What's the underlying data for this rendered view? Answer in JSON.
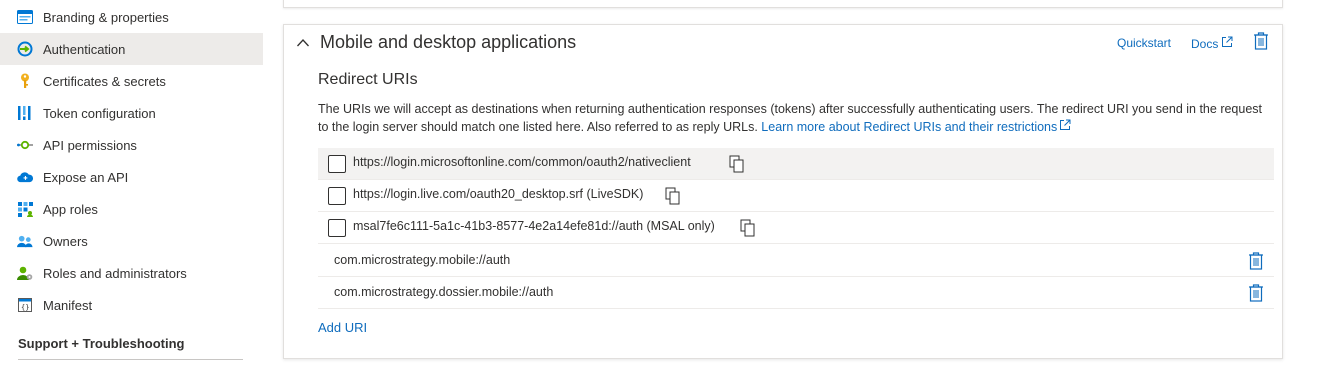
{
  "sidebar": {
    "items": [
      {
        "label": "Branding & properties",
        "icon": "branding-icon"
      },
      {
        "label": "Authentication",
        "icon": "authentication-icon",
        "active": true
      },
      {
        "label": "Certificates & secrets",
        "icon": "key-icon"
      },
      {
        "label": "Token configuration",
        "icon": "token-bars-icon"
      },
      {
        "label": "API permissions",
        "icon": "api-permissions-icon"
      },
      {
        "label": "Expose an API",
        "icon": "cloud-icon"
      },
      {
        "label": "App roles",
        "icon": "app-roles-grid-icon"
      },
      {
        "label": "Owners",
        "icon": "owners-icon"
      },
      {
        "label": "Roles and administrators",
        "icon": "roles-admin-icon"
      },
      {
        "label": "Manifest",
        "icon": "manifest-icon"
      }
    ],
    "support_heading": "Support + Troubleshooting"
  },
  "card": {
    "title": "Mobile and desktop applications",
    "quickstart_label": "Quickstart",
    "docs_label": "Docs",
    "redirect_title": "Redirect URIs",
    "description": "The URIs we will accept as destinations when returning authentication responses (tokens) after successfully authenticating users. The redirect URI you send in the request to the login server should match one listed here. Also referred to as reply URLs.",
    "learn_more_label": "Learn more about Redirect URIs and their restrictions",
    "suggested_uris": [
      {
        "value": "https://login.microsoftonline.com/common/oauth2/nativeclient",
        "checked": false
      },
      {
        "value": "https://login.live.com/oauth20_desktop.srf (LiveSDK)",
        "checked": false
      },
      {
        "value": "msal7fe6c111-5a1c-41b3-8577-4e2a14efe81d://auth (MSAL only)",
        "checked": false
      }
    ],
    "custom_uris": [
      "com.microstrategy.mobile://auth",
      "com.microstrategy.dossier.mobile://auth"
    ],
    "add_uri_label": "Add URI"
  },
  "colors": {
    "accent": "#0f6cbd",
    "active_bg": "#edebe9"
  }
}
